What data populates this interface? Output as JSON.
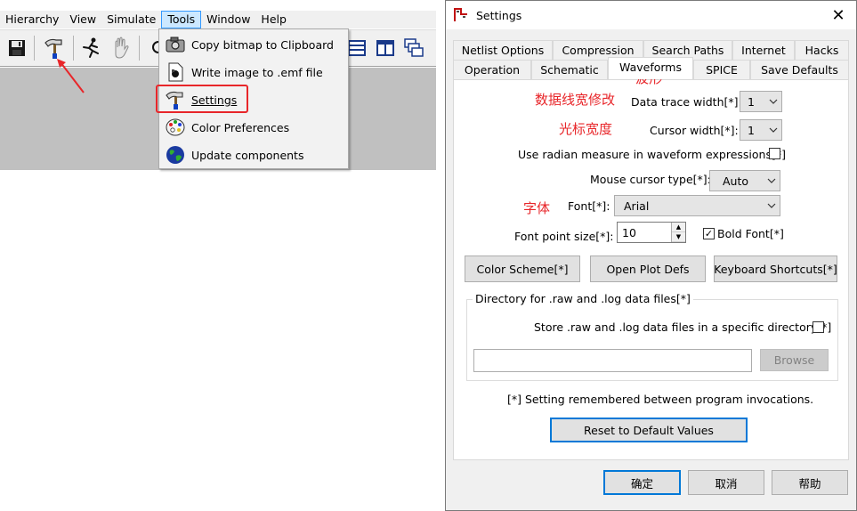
{
  "menubar": {
    "items": [
      "Hierarchy",
      "View",
      "Simulate",
      "Tools",
      "Window",
      "Help"
    ]
  },
  "tools_menu": {
    "items": [
      {
        "label": "Copy bitmap to Clipboard",
        "icon": "camera-icon"
      },
      {
        "label": "Write image to .emf file",
        "icon": "emf-file-icon"
      },
      {
        "label": "Settings",
        "icon": "hammer-icon"
      },
      {
        "label": "Color Preferences",
        "icon": "palette-icon"
      },
      {
        "label": "Update components",
        "icon": "globe-icon"
      }
    ]
  },
  "toolbar": {
    "icons": [
      "save-icon",
      "hammer-icon",
      "run-icon",
      "halt-hand-icon",
      "zoom-icon",
      "window-layout-icon",
      "window-split-icon",
      "window-cascade-icon"
    ]
  },
  "dialog": {
    "title": "Settings",
    "tabs_row1": [
      "Netlist Options",
      "Compression",
      "Search Paths",
      "Internet",
      "Hacks"
    ],
    "tabs_row2": [
      "Operation",
      "Schematic",
      "Waveforms",
      "SPICE",
      "Save Defaults"
    ],
    "selected_tab": "Waveforms",
    "annotations": {
      "tab": "波形",
      "data_trace": "数据线宽修改",
      "cursor": "光标宽度",
      "font": "字体"
    },
    "fields": {
      "data_trace_width_label": "Data trace width[*]:",
      "data_trace_width_value": "1",
      "cursor_width_label": "Cursor width[*]:",
      "cursor_width_value": "1",
      "radian_label": "Use radian measure in waveform expressions[*]",
      "radian_checked": false,
      "mouse_cursor_label": "Mouse cursor type[*]:",
      "mouse_cursor_value": "Auto",
      "font_label": "Font[*]:",
      "font_value": "Arial",
      "font_size_label": "Font point size[*]:",
      "font_size_value": "10",
      "bold_font_label": "Bold Font[*]",
      "bold_font_checked": true
    },
    "buttons": {
      "color_scheme": "Color Scheme[*]",
      "open_plot_defs": "Open Plot Defs",
      "keyboard_shortcuts": "Keyboard Shortcuts[*]"
    },
    "directory_group": {
      "title": "Directory for .raw and .log data files[*]",
      "store_label": "Store .raw and .log data files in a specific directory[*]",
      "store_checked": false,
      "path_value": "",
      "browse_label": "Browse"
    },
    "note": "[*] Setting remembered between program invocations.",
    "reset_label": "Reset to Default Values",
    "footer": {
      "ok_label": "确定",
      "cancel_label": "取消",
      "help_label": "帮助"
    }
  },
  "colors": {
    "annotation_red": "#e8262a",
    "focus_blue": "#0078d7",
    "menu_highlight": "#cce8ff"
  }
}
